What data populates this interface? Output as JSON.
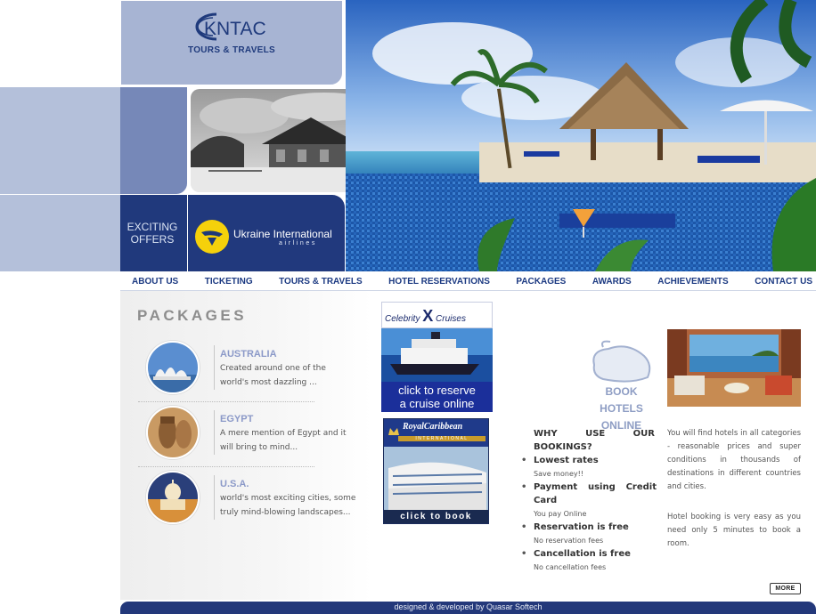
{
  "brand": {
    "logo_text": "KNTAC",
    "tagline": "TOURS & TRAVELS"
  },
  "promo": {
    "exciting_line1": "EXCITING",
    "exciting_line2": "OFFERS",
    "airline_name": "Ukraine International",
    "airline_sub": "airlines"
  },
  "nav": {
    "items": [
      {
        "label": "ABOUT US"
      },
      {
        "label": "TICKETING"
      },
      {
        "label": "TOURS & TRAVELS"
      },
      {
        "label": "HOTEL RESERVATIONS"
      },
      {
        "label": "PACKAGES"
      },
      {
        "label": "AWARDS"
      },
      {
        "label": "ACHIEVEMENTS"
      },
      {
        "label": "CONTACT US"
      }
    ]
  },
  "packages": {
    "title": "PACKAGES",
    "items": [
      {
        "name": "AUSTRALIA",
        "desc_line1": "Created around one of the",
        "desc_line2": "world's most dazzling ..."
      },
      {
        "name": "EGYPT",
        "desc_line1": "A mere mention of Egypt and it",
        "desc_line2": "will bring to mind..."
      },
      {
        "name": "U.S.A.",
        "desc_line1": "world's most exciting cities, some",
        "desc_line2": "truly mind-blowing landscapes..."
      }
    ]
  },
  "ads": {
    "celebrity_brand": "Celebrity",
    "celebrity_x": "X",
    "celebrity_cruises": "Cruises",
    "celebrity_cta_line1": "click to reserve",
    "celebrity_cta_line2": "a cruise online",
    "royal_brand": "RoyalCaribbean",
    "royal_int": "INTERNATIONAL",
    "royal_cta": "click to book"
  },
  "hotels": {
    "book_line1": "BOOK HOTELS",
    "book_line2": "ONLINE",
    "why_title": "WHY USE OUR BOOKINGS?",
    "reasons": [
      {
        "title": "Lowest rates",
        "sub": "Save money!!"
      },
      {
        "title": "Payment using Credit Card",
        "sub": "You pay Online"
      },
      {
        "title": "Reservation is free",
        "sub": "No reservation fees"
      },
      {
        "title": "Cancellation is free",
        "sub": "No cancellation fees"
      }
    ],
    "text1": "You will find hotels in all categories - reasonable prices and super conditions in thousands of destinations in different countries and cities.",
    "text2": "Hotel booking is very easy as you need only 5 minutes to book a room.",
    "more_label": "MORE"
  },
  "footer": {
    "credit": "designed & developed by Quasar Softech"
  },
  "colors": {
    "brand_navy": "#20397c",
    "nav_text": "#1c3a82",
    "block_light": "#b4c0da",
    "block_mid": "#7688b8",
    "package_heading": "#8b99c8"
  }
}
